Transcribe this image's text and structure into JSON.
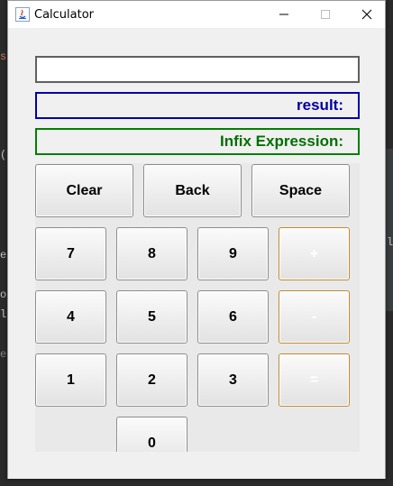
{
  "window": {
    "title": "Calculator",
    "controls": {
      "minimize": "—",
      "maximize": "☐",
      "close": "✕"
    }
  },
  "fields": {
    "input_value": "",
    "result_label": "result:",
    "infix_label": "Infix Expression:"
  },
  "keypad": {
    "row1": [
      "Clear",
      "Back",
      "Space"
    ],
    "row2": [
      "7",
      "8",
      "9",
      "+"
    ],
    "row3": [
      "4",
      "5",
      "6",
      "-"
    ],
    "row4": [
      "1",
      "2",
      "3",
      "="
    ],
    "row5": [
      "0"
    ]
  },
  "background": {
    "left_glyphs": [
      "s",
      "(",
      "e",
      "o",
      "l",
      "ex"
    ],
    "right_glyph": "l:"
  },
  "colors": {
    "result": "#0000a0",
    "infix": "#006f00",
    "operator_border": "#c08a30"
  }
}
